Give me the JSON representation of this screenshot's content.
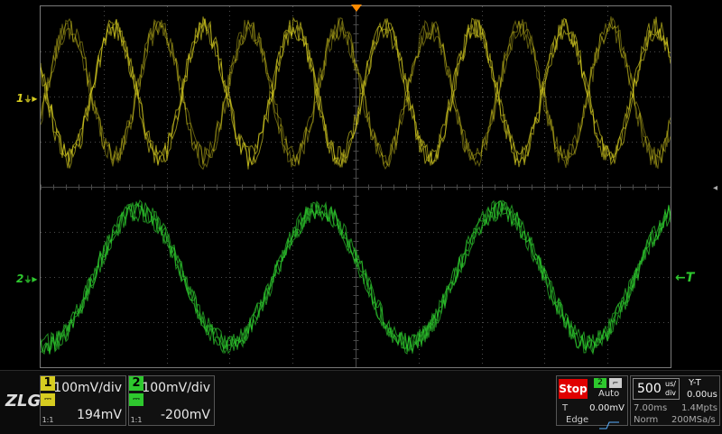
{
  "colors": {
    "ch1": "#d6cc20",
    "ch2": "#2ec82e",
    "grid": "#4a4a4a",
    "trigger_marker": "#ff8a00",
    "stop": "#e00000"
  },
  "logo_text": "ZLG",
  "registered_mark": "®",
  "markers": {
    "ch1_label": "1",
    "ch2_label": "2",
    "trigger_level": "T",
    "ch1_ground_glyph": "⏚",
    "ch2_ground_glyph": "⏚"
  },
  "channels": [
    {
      "number": "1",
      "scale": "100mV/div",
      "offset": "194mV",
      "probe": "1:1",
      "coupling_icon": "dc-coupling-icon"
    },
    {
      "number": "2",
      "scale": "100mV/div",
      "offset": "-200mV",
      "probe": "1:1",
      "coupling_icon": "dc-coupling-icon"
    }
  ],
  "run_state": "Stop",
  "trigger": {
    "source": "2",
    "mode": "Auto",
    "label": "T",
    "level": "0.00mV",
    "type": "Edge",
    "edge_icon": "rising-edge-icon"
  },
  "timebase": {
    "scale_value": "500",
    "scale_unit_top": "us/",
    "scale_unit_bottom": "div",
    "mode": "Y-T",
    "delay": "0.00us"
  },
  "acquisition": {
    "window": "7.00ms",
    "memory": "1.4Mpts",
    "mode": "Norm",
    "sample_rate": "200MSa/s"
  },
  "side_arrow_icon": "chevron-left-icon"
}
